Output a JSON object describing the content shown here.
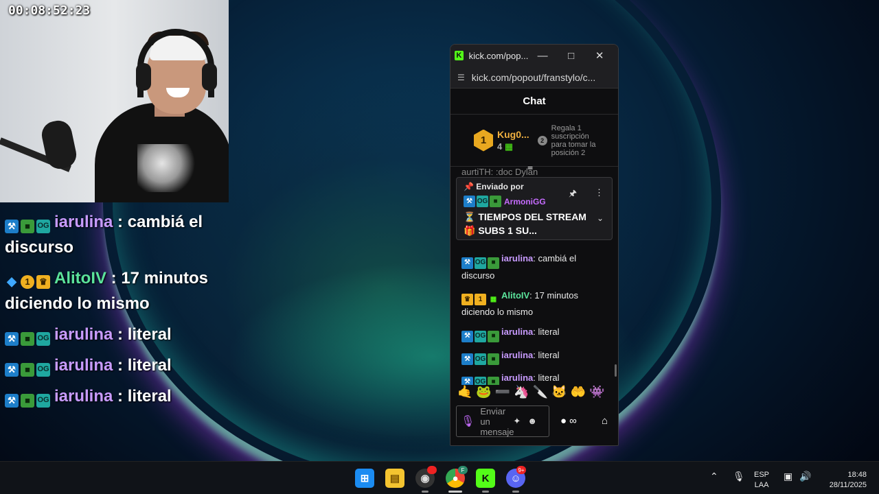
{
  "stream": {
    "timer": "00:08:52:23"
  },
  "overlay_chat": [
    {
      "user": "iarulina",
      "text": ": cambiá el discurso",
      "badges": [
        "hammer",
        "creeper",
        "og"
      ],
      "color": "#c89bff"
    },
    {
      "user": "AlitoIV",
      "text": ": 17 minutos diciendo lo mismo",
      "badges": [
        "cube",
        "one",
        "crown"
      ],
      "color": "#5be39b"
    },
    {
      "user": "iarulina",
      "text": ": literal",
      "badges": [
        "hammer",
        "creeper",
        "og"
      ],
      "color": "#c89bff"
    },
    {
      "user": "iarulina",
      "text": ": literal",
      "badges": [
        "hammer",
        "creeper",
        "og"
      ],
      "color": "#c89bff"
    },
    {
      "user": "iarulina",
      "text": ": literal",
      "badges": [
        "hammer",
        "creeper",
        "og"
      ],
      "color": "#c89bff"
    }
  ],
  "popout": {
    "window_title": "kick.com/pop...",
    "url": "kick.com/popout/franstylo/c...",
    "chat_title": "Chat",
    "leaderboard": {
      "rank1": "1",
      "user": "Kug0...",
      "count": "4",
      "rank2": "2",
      "cta": "Regala 1 suscripción para tomar la posición 2"
    },
    "ghost_line": "aurtiTH: :doc Dylan",
    "pinned": {
      "header": "Enviado por",
      "user": "ArmoniGG",
      "text": "⏳ TIEMPOS DEL STREAM 🎁 SUBS 1 SU..."
    },
    "messages": [
      {
        "user": "iarulina",
        "text": ": cambiá el discurso",
        "badges": [
          "hammer",
          "og",
          "creeper"
        ],
        "color": "#c89bff"
      },
      {
        "user": "AlitoIV",
        "text": ": 17 minutos diciendo lo mismo",
        "badges": [
          "crown",
          "one",
          "gift"
        ],
        "color": "#5be39b"
      },
      {
        "user": "iarulina",
        "text": ": literal",
        "badges": [
          "hammer",
          "og",
          "creeper"
        ],
        "color": "#c89bff"
      },
      {
        "user": "iarulina",
        "text": ": literal",
        "badges": [
          "hammer",
          "og",
          "creeper"
        ],
        "color": "#c89bff"
      },
      {
        "user": "iarulina",
        "text": ": literal",
        "badges": [
          "hammer",
          "og",
          "creeper"
        ],
        "color": "#c89bff"
      }
    ],
    "emotes": [
      "🤙",
      "🐸",
      "➖",
      "🦄",
      "🔪",
      "🐱",
      "🤲",
      "👾"
    ],
    "composer_placeholder": "Enviar un mensaje",
    "accent": "#53fc18"
  },
  "taskbar": {
    "lang_top": "ESP",
    "lang_bottom": "LAA",
    "time": "18:48",
    "date": "28/11/2025",
    "chrome_profile": "F",
    "discord_badge": "9+"
  }
}
